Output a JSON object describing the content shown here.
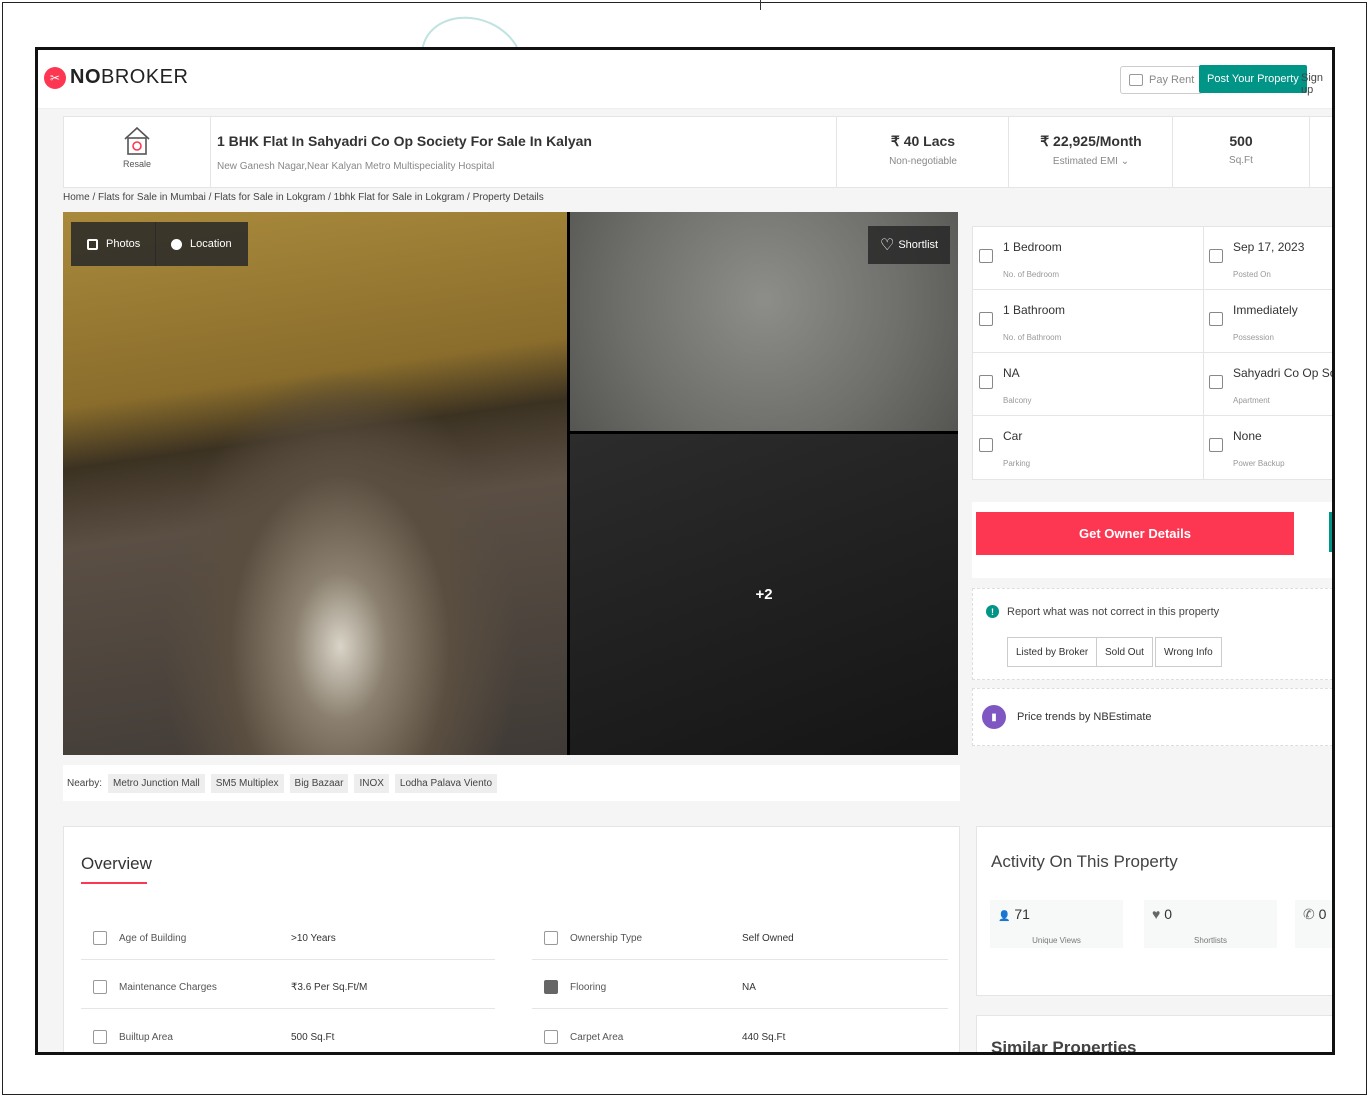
{
  "header": {
    "logo_no": "NO",
    "logo_broker": "BROKER",
    "pay_rent": "Pay Rent",
    "post_property": "Post Your Property",
    "sign_up": "Sign up"
  },
  "summary": {
    "type_label": "Resale",
    "title": "1 BHK Flat In Sahyadri Co Op Society For Sale In Kalyan",
    "address": "New Ganesh Nagar,Near Kalyan Metro Multispeciality Hospital",
    "price": "₹ 40 Lacs",
    "price_note": "Non-negotiable",
    "emi": "₹ 22,925/Month",
    "emi_note": "Estimated EMI ⌄",
    "area": "500",
    "area_unit": "Sq.Ft"
  },
  "breadcrumb": "Home / Flats for Sale in Mumbai / Flats for Sale in Lokgram / 1bhk Flat for Sale in Lokgram / Property Details",
  "gallery": {
    "photos_label": "Photos",
    "location_label": "Location",
    "shortlist_label": "Shortlist",
    "more_count": "+2"
  },
  "nearby": {
    "label": "Nearby:",
    "places": [
      "Metro Junction Mall",
      "SM5 Multiplex",
      "Big Bazaar",
      "INOX",
      "Lodha Palava Viento"
    ]
  },
  "specs": [
    {
      "value": "1 Bedroom",
      "label": "No. of Bedroom",
      "icon": "bed-icon"
    },
    {
      "value": "Sep 17, 2023",
      "label": "Posted On",
      "icon": "calendar-icon"
    },
    {
      "value": "1 Bathroom",
      "label": "No. of Bathroom",
      "icon": "bathtub-icon"
    },
    {
      "value": "Immediately",
      "label": "Possession",
      "icon": "key-icon"
    },
    {
      "value": "NA",
      "label": "Balcony",
      "icon": "balcony-icon"
    },
    {
      "value": "Sahyadri Co Op Soc...",
      "label": "Apartment",
      "icon": "building-icon"
    },
    {
      "value": "Car",
      "label": "Parking",
      "icon": "car-icon"
    },
    {
      "value": "None",
      "label": "Power Backup",
      "icon": "battery-icon"
    }
  ],
  "cta": {
    "label": "Get Owner Details",
    "color": "#fd3752"
  },
  "report": {
    "text": "Report what was not correct in this property",
    "buttons": [
      "Listed by Broker",
      "Sold Out",
      "Wrong Info"
    ]
  },
  "price_trend": "Price trends by NBEstimate",
  "overview": {
    "title": "Overview",
    "items": [
      {
        "label": "Age of Building",
        "value": ">10 Years",
        "icon": "calendar-icon"
      },
      {
        "label": "Ownership Type",
        "value": "Self Owned",
        "icon": "person-icon"
      },
      {
        "label": "Maintenance Charges",
        "value": "₹3.6 Per Sq.Ft/M",
        "icon": "tools-icon"
      },
      {
        "label": "Flooring",
        "value": "NA",
        "icon": "grid-icon"
      },
      {
        "label": "Builtup Area",
        "value": "500 Sq.Ft",
        "icon": "building-icon"
      },
      {
        "label": "Carpet Area",
        "value": "440 Sq.Ft",
        "icon": "floorplan-icon"
      }
    ]
  },
  "activity": {
    "title": "Activity On This Property",
    "stats": [
      {
        "icon": "person-icon",
        "glyph": "👤",
        "value": "71",
        "label": "Unique Views"
      },
      {
        "icon": "heart-icon",
        "glyph": "♥",
        "value": "0",
        "label": "Shortlists"
      },
      {
        "icon": "phone-icon",
        "glyph": "✆",
        "value": "0",
        "label": ""
      }
    ]
  },
  "similar_title": "Similar Properties",
  "colors": {
    "brand": "#fd3752",
    "accent": "#009587",
    "trend": "#7e57c2"
  }
}
